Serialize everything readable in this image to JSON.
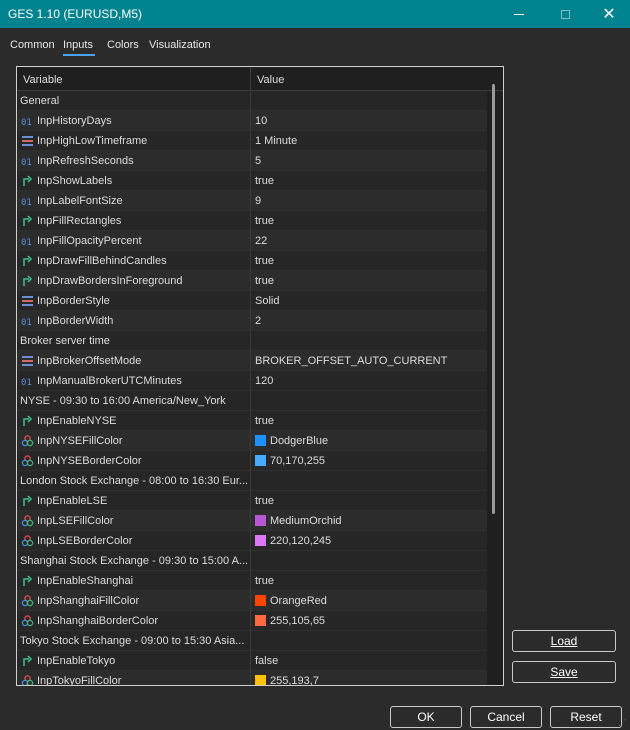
{
  "window": {
    "title": "GES 1.10 (EURUSD,M5)"
  },
  "tabs": [
    {
      "label": "Common"
    },
    {
      "label": "Inputs"
    },
    {
      "label": "Colors"
    },
    {
      "label": "Visualization"
    }
  ],
  "table": {
    "header_variable": "Variable",
    "header_value": "Value"
  },
  "rows": [
    {
      "type": "group",
      "label": "General"
    },
    {
      "type": "int",
      "icon": "int-icon",
      "name": "InpHistoryDays",
      "value": "10"
    },
    {
      "type": "enum",
      "icon": "enum-icon",
      "name": "InpHighLowTimeframe",
      "value": "1 Minute"
    },
    {
      "type": "int",
      "icon": "int-icon",
      "name": "InpRefreshSeconds",
      "value": "5"
    },
    {
      "type": "bool",
      "icon": "bool-icon",
      "name": "InpShowLabels",
      "value": "true"
    },
    {
      "type": "int",
      "icon": "int-icon",
      "name": "InpLabelFontSize",
      "value": "9"
    },
    {
      "type": "bool",
      "icon": "bool-icon",
      "name": "InpFillRectangles",
      "value": "true"
    },
    {
      "type": "int",
      "icon": "int-icon",
      "name": "InpFillOpacityPercent",
      "value": "22"
    },
    {
      "type": "bool",
      "icon": "bool-icon",
      "name": "InpDrawFillBehindCandles",
      "value": "true"
    },
    {
      "type": "bool",
      "icon": "bool-icon",
      "name": "InpDrawBordersInForeground",
      "value": "true"
    },
    {
      "type": "enum",
      "icon": "enum-icon",
      "name": "InpBorderStyle",
      "value": "Solid"
    },
    {
      "type": "int",
      "icon": "int-icon",
      "name": "InpBorderWidth",
      "value": "2"
    },
    {
      "type": "group",
      "label": "Broker server time"
    },
    {
      "type": "enum",
      "icon": "enum-icon",
      "name": "InpBrokerOffsetMode",
      "value": "BROKER_OFFSET_AUTO_CURRENT"
    },
    {
      "type": "int",
      "icon": "int-icon",
      "name": "InpManualBrokerUTCMinutes",
      "value": "120"
    },
    {
      "type": "group",
      "label": "NYSE - 09:30 to 16:00 America/New_York"
    },
    {
      "type": "bool",
      "icon": "bool-icon",
      "name": "InpEnableNYSE",
      "value": "true"
    },
    {
      "type": "color",
      "icon": "color-icon",
      "name": "InpNYSEFillColor",
      "value": "DodgerBlue",
      "swatch": "#1e90ff"
    },
    {
      "type": "color",
      "icon": "color-icon",
      "name": "InpNYSEBorderColor",
      "value": "70,170,255",
      "swatch": "#46aaff"
    },
    {
      "type": "group",
      "label": "London Stock Exchange - 08:00 to 16:30 Eur..."
    },
    {
      "type": "bool",
      "icon": "bool-icon",
      "name": "InpEnableLSE",
      "value": "true"
    },
    {
      "type": "color",
      "icon": "color-icon",
      "name": "InpLSEFillColor",
      "value": "MediumOrchid",
      "swatch": "#ba55d3"
    },
    {
      "type": "color",
      "icon": "color-icon",
      "name": "InpLSEBorderColor",
      "value": "220,120,245",
      "swatch": "#dc78f5"
    },
    {
      "type": "group",
      "label": "Shanghai Stock Exchange - 09:30 to 15:00 A..."
    },
    {
      "type": "bool",
      "icon": "bool-icon",
      "name": "InpEnableShanghai",
      "value": "true"
    },
    {
      "type": "color",
      "icon": "color-icon",
      "name": "InpShanghaiFillColor",
      "value": "OrangeRed",
      "swatch": "#ff4500"
    },
    {
      "type": "color",
      "icon": "color-icon",
      "name": "InpShanghaiBorderColor",
      "value": "255,105,65",
      "swatch": "#ff6941"
    },
    {
      "type": "group",
      "label": "Tokyo Stock Exchange - 09:00 to 15:30 Asia..."
    },
    {
      "type": "bool",
      "icon": "bool-icon",
      "name": "InpEnableTokyo",
      "value": "false"
    },
    {
      "type": "color",
      "icon": "color-icon",
      "name": "InpTokyoFillColor",
      "value": "255,193,7",
      "swatch": "#ffc107"
    }
  ],
  "buttons": {
    "load": "Load",
    "save": "Save",
    "ok": "OK",
    "cancel": "Cancel",
    "reset": "Reset"
  },
  "colors": {
    "titlebar": "#00838f",
    "int_icon": "#5b8fd8",
    "bool_icon": "#3fbf8a",
    "enum_icon": "#6b8fd6",
    "tab_underline": "#4aa3f0"
  }
}
